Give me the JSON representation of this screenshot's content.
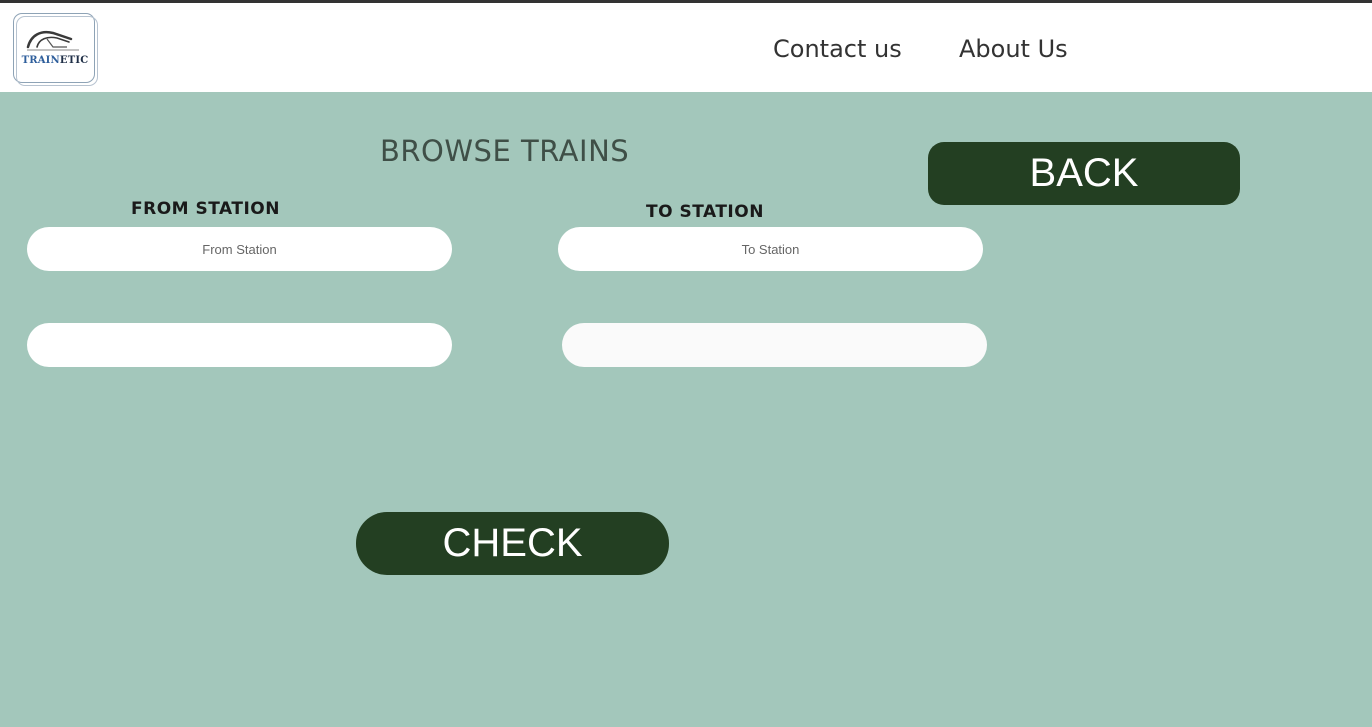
{
  "header": {
    "logo": {
      "icon": "train-icon",
      "text_part1": "TRAIN",
      "text_part2": "ETIC"
    },
    "nav": {
      "contact_label": "Contact us",
      "about_label": "About Us"
    }
  },
  "main": {
    "title": "BROWSE TRAINS",
    "back_label": "BACK",
    "from_label": "FROM STATION",
    "to_label": "TO STATION",
    "from_placeholder": "From Station",
    "to_placeholder": "To Station",
    "row2_left_value": "",
    "row2_right_value": "",
    "check_label": "CHECK"
  },
  "colors": {
    "background": "#a3c7bb",
    "header_background": "#ffffff",
    "button_background": "#233f22",
    "button_text": "#ffffff",
    "logo_blue": "#2f5f9c"
  }
}
